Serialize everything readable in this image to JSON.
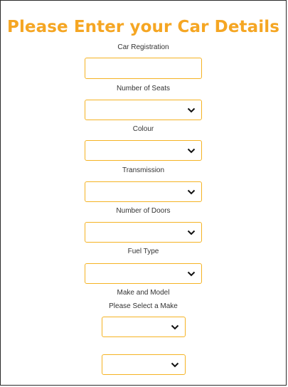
{
  "page": {
    "title": "Please Enter your Car Details"
  },
  "form": {
    "registration": {
      "label": "Car Registration",
      "value": ""
    },
    "seats": {
      "label": "Number of Seats",
      "selected": ""
    },
    "colour": {
      "label": "Colour",
      "selected": ""
    },
    "transmission": {
      "label": "Transmission",
      "selected": ""
    },
    "doors": {
      "label": "Number of Doors",
      "selected": ""
    },
    "fuel": {
      "label": "Fuel Type",
      "selected": ""
    },
    "make_model": {
      "label": "Make and Model",
      "make_prompt": "Please Select a Make",
      "make_selected": "",
      "model_selected": ""
    }
  },
  "icons": {
    "dropdown": "chevron-down-icon"
  },
  "colors": {
    "accent": "#f5a623",
    "border": "#f5b323"
  }
}
